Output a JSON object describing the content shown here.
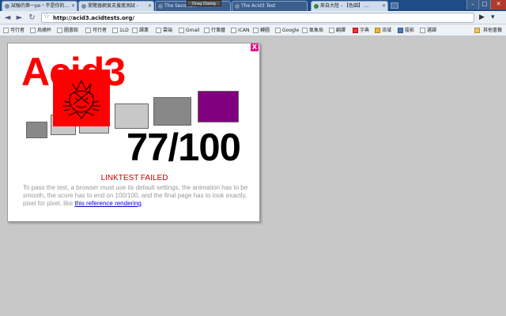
{
  "tabs": [
    {
      "label": "試驗的第一po・不是你的...",
      "state": "normal"
    },
    {
      "label": "瀏覽器網頁支援度測試 -",
      "state": "normal"
    },
    {
      "label": "The Second...",
      "state": "dark"
    },
    {
      "label": "The Acid3 Test",
      "state": "active"
    },
    {
      "label": "來自大陸 - 【色園】 ...",
      "state": "normal"
    }
  ],
  "tooltip": "Drag Dialog",
  "window_controls": {
    "minimize": "–",
    "maximize": "□",
    "close": "✕"
  },
  "toolbar": {
    "back": "◄",
    "forward": "►",
    "reload": "↻",
    "url": "http://acid3.acidtests.org/",
    "page_icon": "▶",
    "tools_icon": "▾"
  },
  "bookmarks": [
    "可行者",
    "烏鴉杯",
    "圖書館",
    "可行者",
    "1LD",
    "課業",
    "雲端",
    "Gmail",
    "行事曆",
    "iCAN",
    "轉圖",
    "Google",
    "氣象局",
    "翻譯",
    "字典",
    "流域",
    "股影",
    "選課"
  ],
  "other_bookmarks": "其他書籤",
  "acid": {
    "close": "X",
    "title": "Acid3",
    "score": "77/100",
    "result": "LINKTEST FAILED",
    "description": "To pass the test, a browser must use its default settings, the animation has to be smooth, the score has to end on 100/100, and the final page has to look exactly, pixel for pixel, like",
    "link_text": "this reference rendering",
    "period": "."
  }
}
